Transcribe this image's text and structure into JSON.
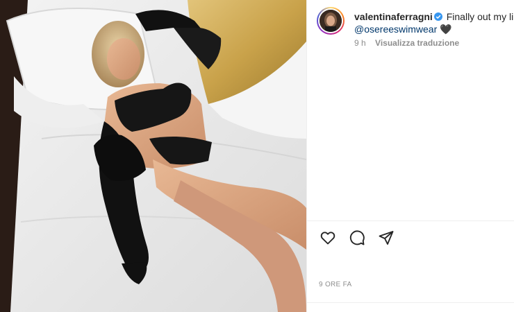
{
  "post": {
    "username": "valentinaferragni",
    "caption": "Finally out my lingerie collection with",
    "mention": "@osereeswimwear",
    "emoji": "🖤",
    "relative_time": "9 h",
    "translate_label": "Visualizza traduzione",
    "timestamp": "9 ORE FA",
    "verified": true
  },
  "actions": {
    "like": "heart-icon",
    "comment": "comment-icon",
    "share": "share-icon"
  },
  "colors": {
    "verified_badge": "#3897f0",
    "mention": "#00376b",
    "secondary_text": "#8e8e8e",
    "gold_pillow": "#c9a24a"
  }
}
